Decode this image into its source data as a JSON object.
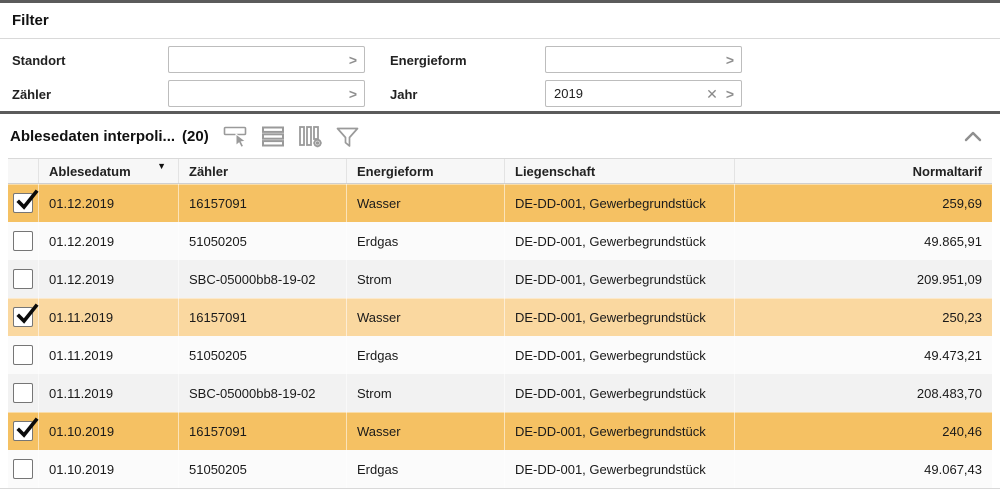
{
  "filter_panel": {
    "title": "Filter",
    "fields": [
      {
        "label": "Standort",
        "value": "",
        "clearable": false
      },
      {
        "label": "Energieform",
        "value": "",
        "clearable": false
      },
      {
        "label": "Zähler",
        "value": "",
        "clearable": false
      },
      {
        "label": "Jahr",
        "value": "2019",
        "clearable": true
      }
    ],
    "value_help_glyph": ">",
    "clear_glyph": "✕"
  },
  "table_panel": {
    "title": "Ablesedaten interpoli...",
    "count": "(20)",
    "toolbar_icons": [
      "select-rows-icon",
      "rows-icon",
      "column-settings-icon",
      "filter-funnel-icon"
    ],
    "collapse_icon": "chevron-up-icon",
    "columns": [
      "Ablesedatum",
      "Zähler",
      "Energieform",
      "Liegenschaft",
      "Normaltarif"
    ],
    "sort": {
      "column": "Ablesedatum",
      "direction": "desc",
      "glyph": "▼"
    },
    "rows": [
      {
        "checked": true,
        "ablesedatum": "01.12.2019",
        "zaehler": "16157091",
        "energieform": "Wasser",
        "liegenschaft": "DE-DD-001, Gewerbegrundstück",
        "normaltarif": "259,69"
      },
      {
        "checked": false,
        "ablesedatum": "01.12.2019",
        "zaehler": "51050205",
        "energieform": "Erdgas",
        "liegenschaft": "DE-DD-001, Gewerbegrundstück",
        "normaltarif": "49.865,91"
      },
      {
        "checked": false,
        "ablesedatum": "01.12.2019",
        "zaehler": "SBC-05000bb8-19-02",
        "energieform": "Strom",
        "liegenschaft": "DE-DD-001, Gewerbegrundstück",
        "normaltarif": "209.951,09"
      },
      {
        "checked": true,
        "ablesedatum": "01.11.2019",
        "zaehler": "16157091",
        "energieform": "Wasser",
        "liegenschaft": "DE-DD-001, Gewerbegrundstück",
        "normaltarif": "250,23"
      },
      {
        "checked": false,
        "ablesedatum": "01.11.2019",
        "zaehler": "51050205",
        "energieform": "Erdgas",
        "liegenschaft": "DE-DD-001, Gewerbegrundstück",
        "normaltarif": "49.473,21"
      },
      {
        "checked": false,
        "ablesedatum": "01.11.2019",
        "zaehler": "SBC-05000bb8-19-02",
        "energieform": "Strom",
        "liegenschaft": "DE-DD-001, Gewerbegrundstück",
        "normaltarif": "208.483,70"
      },
      {
        "checked": true,
        "ablesedatum": "01.10.2019",
        "zaehler": "16157091",
        "energieform": "Wasser",
        "liegenschaft": "DE-DD-001, Gewerbegrundstück",
        "normaltarif": "240,46"
      },
      {
        "checked": false,
        "ablesedatum": "01.10.2019",
        "zaehler": "51050205",
        "energieform": "Erdgas",
        "liegenschaft": "DE-DD-001, Gewerbegrundstück",
        "normaltarif": "49.067,43"
      }
    ]
  },
  "colors": {
    "selection_dark": "#F5C163",
    "selection_light": "#FAD8A0",
    "row_alt": "#F2F2F2",
    "panel_border": "#5B5B5B",
    "icon_gray": "#9A9A9A"
  }
}
